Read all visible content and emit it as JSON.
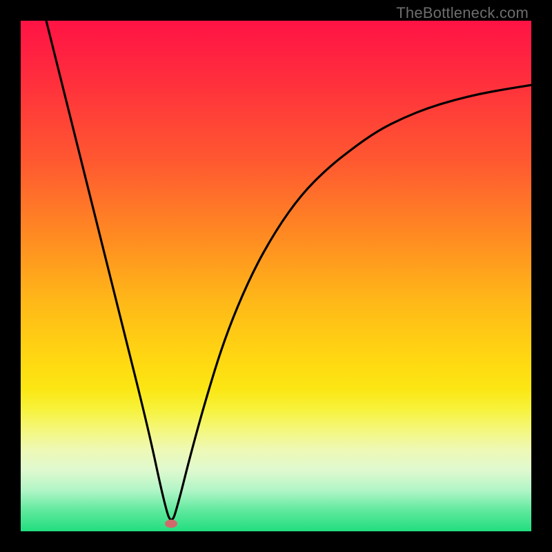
{
  "watermark": "TheBottleneck.com",
  "marker": {
    "x_pct": 29.5,
    "y_pct": 98.5
  },
  "colors": {
    "frame_bg": "#000000",
    "marker": "#d06a6a",
    "curve": "#000000",
    "watermark": "#6d6d6d"
  },
  "chart_data": {
    "type": "line",
    "title": "",
    "xlabel": "",
    "ylabel": "",
    "xlim": [
      0,
      100
    ],
    "ylim": [
      0,
      100
    ],
    "series": [
      {
        "name": "curve",
        "x": [
          5,
          10,
          15,
          20,
          25,
          28,
          29.5,
          31,
          33,
          36,
          40,
          45,
          50,
          55,
          60,
          65,
          70,
          75,
          80,
          85,
          90,
          95,
          100
        ],
        "y": [
          100,
          80,
          60,
          40,
          20,
          6,
          1,
          6,
          14,
          25,
          38,
          50,
          59,
          66,
          71,
          75,
          78.5,
          81,
          83,
          84.5,
          85.7,
          86.6,
          87.4
        ]
      }
    ],
    "annotations": [
      {
        "type": "marker",
        "x": 29.5,
        "y": 1.5,
        "shape": "ellipse",
        "color": "#d06a6a"
      }
    ],
    "background_gradient": {
      "direction": "vertical",
      "stops": [
        {
          "pos": 0.0,
          "color": "#ff1345"
        },
        {
          "pos": 0.28,
          "color": "#ff5a30"
        },
        {
          "pos": 0.55,
          "color": "#ffb818"
        },
        {
          "pos": 0.76,
          "color": "#f7f23a"
        },
        {
          "pos": 0.88,
          "color": "#dff9cf"
        },
        {
          "pos": 1.0,
          "color": "#22dd7f"
        }
      ]
    }
  }
}
